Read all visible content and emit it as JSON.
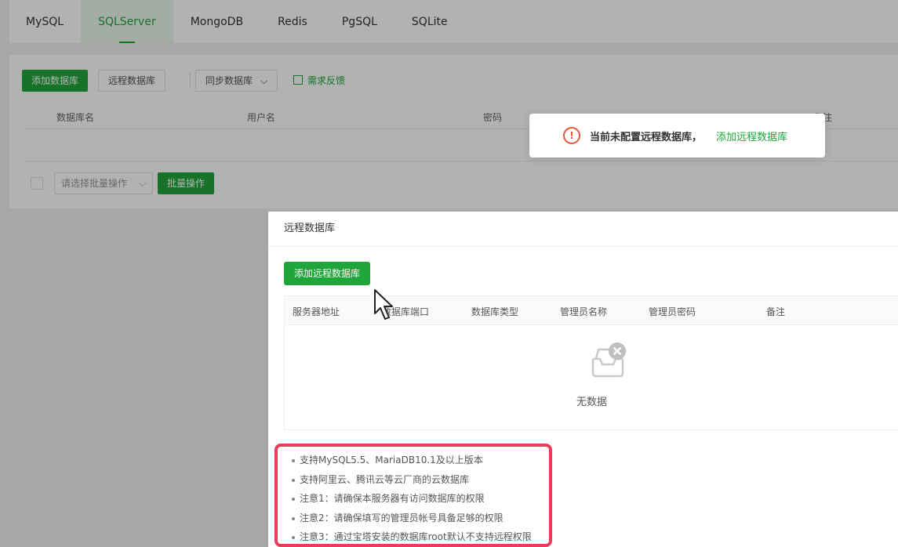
{
  "tabs": [
    {
      "label": "MySQL",
      "active": false
    },
    {
      "label": "SQLServer",
      "active": true
    },
    {
      "label": "MongoDB",
      "active": false
    },
    {
      "label": "Redis",
      "active": false
    },
    {
      "label": "PgSQL",
      "active": false
    },
    {
      "label": "SQLite",
      "active": false
    }
  ],
  "toolbar": {
    "add_db": "添加数据库",
    "remote_db": "远程数据库",
    "sync_db": "同步数据库",
    "feedback": "需求反馈"
  },
  "table": {
    "headers": [
      "数据库名",
      "用户名",
      "密码",
      "备注"
    ]
  },
  "batch": {
    "select_placeholder": "请选择批量操作",
    "button": "批量操作"
  },
  "toast": {
    "message": "当前未配置远程数据库，",
    "link": "添加远程数据库"
  },
  "dialog": {
    "title": "远程数据库",
    "add_button": "添加远程数据库",
    "headers": [
      "服务器地址",
      "数据库端口",
      "数据库类型",
      "管理员名称",
      "管理员密码",
      "备注"
    ],
    "empty_text": "无数据",
    "notes": [
      "支持MySQL5.5、MariaDB10.1及以上版本",
      "支持阿里云、腾讯云等云厂商的云数据库",
      "注意1：请确保本服务器有访问数据库的权限",
      "注意2：请确保填写的管理员帐号具备足够的权限",
      "注意3：通过宝塔安装的数据库root默认不支持远程权限"
    ]
  },
  "colors": {
    "accent": "#20a53a",
    "warning": "#e6563a",
    "highlight_border": "#f03a5c"
  },
  "icons": {
    "toast": "warning-circle-icon",
    "empty": "empty-inbox-icon",
    "feedback": "edit-icon"
  }
}
